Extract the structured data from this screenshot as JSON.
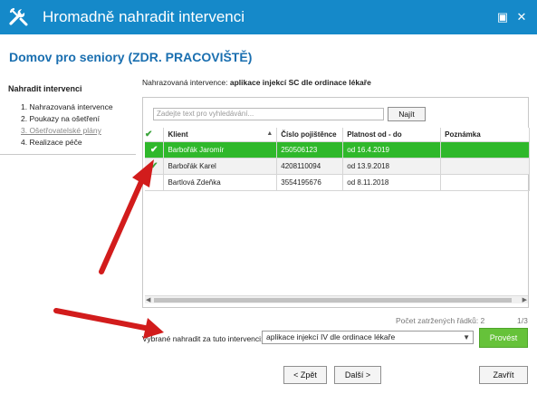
{
  "window": {
    "title": "Hromadně nahradit intervenci",
    "icon": "wrench-icon",
    "colors": {
      "titlebar": "#1589c9",
      "accent": "#1a6fb0",
      "selected_row": "#2fb82b",
      "primary_button": "#66c23a"
    }
  },
  "subtitle": "Domov pro seniory (ZDR. PRACOVIŠTĚ)",
  "sidebar": {
    "heading": "Nahradit intervenci",
    "steps": [
      {
        "label": "1. Nahrazovaná intervence"
      },
      {
        "label": "2. Poukazy na ošetření"
      },
      {
        "label": "3. Ošetřovatelské plány"
      },
      {
        "label": "4. Realizace péče"
      }
    ]
  },
  "intervention": {
    "label": "Nahrazovaná intervence:",
    "value": "aplikace injekcí SC dle ordinace lékaře"
  },
  "search": {
    "placeholder": "Zadejte text pro vyhledávání...",
    "button": "Najít"
  },
  "grid": {
    "columns": [
      "Klient",
      "Číslo pojištěnce",
      "Platnost od - do",
      "Poznámka"
    ],
    "rows": [
      {
        "checked": true,
        "client": "Barbořák Jaromír",
        "insurance": "250506123",
        "validity": "od 16.4.2019",
        "note": ""
      },
      {
        "checked": true,
        "client": "Barbořák Karel",
        "insurance": "4208110094",
        "validity": "od 13.9.2018",
        "note": ""
      },
      {
        "checked": false,
        "client": "Bartlová Zdeňka",
        "insurance": "3554195676",
        "validity": "od 8.11.2018",
        "note": ""
      }
    ],
    "selected_row": 0
  },
  "status": {
    "count": "Počet zatržených řádků: 2",
    "page": "1/3"
  },
  "replace": {
    "label": "Vybrané nahradit za tuto intervenci:",
    "selected": "aplikace injekcí IV dle ordinace lékaře",
    "button": "Provést"
  },
  "footer": {
    "back": "< Zpět",
    "next": "Další >",
    "close": "Zavřít"
  }
}
